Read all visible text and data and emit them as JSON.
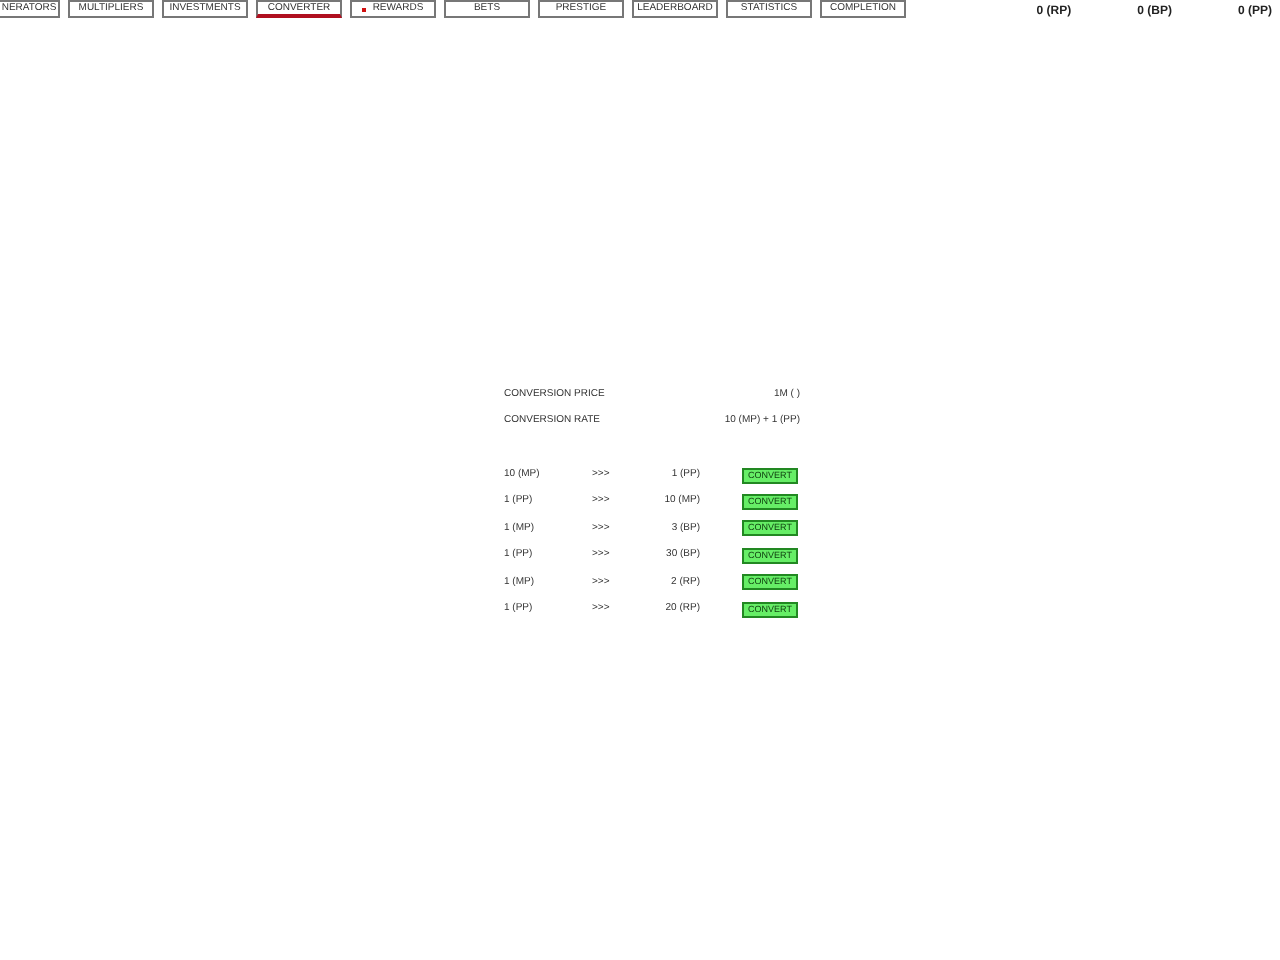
{
  "tabs": [
    {
      "label": "NERATORS",
      "selected": false,
      "notification": false
    },
    {
      "label": "MULTIPLIERS",
      "selected": false,
      "notification": false
    },
    {
      "label": "INVESTMENTS",
      "selected": false,
      "notification": false
    },
    {
      "label": "CONVERTER",
      "selected": true,
      "notification": false
    },
    {
      "label": "REWARDS",
      "selected": false,
      "notification": true
    },
    {
      "label": "BETS",
      "selected": false,
      "notification": false
    },
    {
      "label": "PRESTIGE",
      "selected": false,
      "notification": false
    },
    {
      "label": "LEADERBOARD",
      "selected": false,
      "notification": false
    },
    {
      "label": "STATISTICS",
      "selected": false,
      "notification": false
    },
    {
      "label": "COMPLETION",
      "selected": false,
      "notification": false
    }
  ],
  "currencies": [
    "0 (RP)",
    "0 (BP)",
    "0 (PP)"
  ],
  "converter": {
    "price_label": "CONVERSION PRICE",
    "price_value": "1M ( )",
    "rate_label": "CONVERSION RATE",
    "rate_value": "10 (MP) + 1 (PP)",
    "rows": [
      {
        "from": "10 (MP)",
        "arrow": ">>>",
        "to": "1 (PP)",
        "button": "CONVERT"
      },
      {
        "from": "1 (PP)",
        "arrow": ">>>",
        "to": "10 (MP)",
        "button": "CONVERT"
      },
      {
        "from": "1 (MP)",
        "arrow": ">>>",
        "to": "3 (BP)",
        "button": "CONVERT"
      },
      {
        "from": "1 (PP)",
        "arrow": ">>>",
        "to": "30 (BP)",
        "button": "CONVERT"
      },
      {
        "from": "1 (MP)",
        "arrow": ">>>",
        "to": "2 (RP)",
        "button": "CONVERT"
      },
      {
        "from": "1 (PP)",
        "arrow": ">>>",
        "to": "20 (RP)",
        "button": "CONVERT"
      }
    ]
  }
}
